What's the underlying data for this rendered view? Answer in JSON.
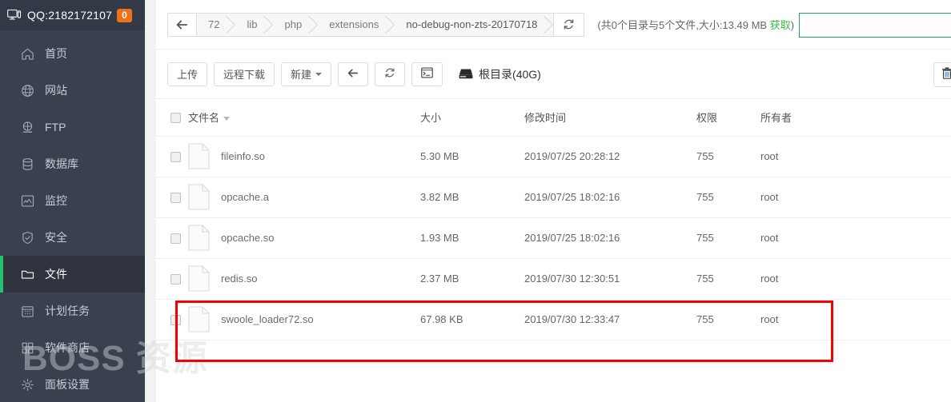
{
  "sidebar": {
    "header": {
      "icon": "monitor-icon",
      "qq_label": "QQ:2182172107",
      "badge_count": "0",
      "bg_color": "#333a47"
    },
    "bg_color": "#3a404d",
    "active_accent_color": "#25c16f",
    "watermark": "BOSS 资源",
    "items": [
      {
        "icon": "home-icon",
        "label": "首页",
        "active": false
      },
      {
        "icon": "globe-icon",
        "label": "网站",
        "active": false
      },
      {
        "icon": "ftp-icon",
        "label": "FTP",
        "active": false
      },
      {
        "icon": "database-icon",
        "label": "数据库",
        "active": false
      },
      {
        "icon": "monitor-chart-icon",
        "label": "监控",
        "active": false
      },
      {
        "icon": "shield-icon",
        "label": "安全",
        "active": false
      },
      {
        "icon": "folder-icon",
        "label": "文件",
        "active": true
      },
      {
        "icon": "calendar-icon",
        "label": "计划任务",
        "active": false
      },
      {
        "icon": "grid-icon",
        "label": "软件商店",
        "active": false
      },
      {
        "icon": "gear-icon",
        "label": "面板设置",
        "active": false
      }
    ]
  },
  "breadcrumb": {
    "back_icon": "arrow-left-icon",
    "crumbs": [
      "72",
      "lib",
      "php",
      "extensions",
      "no-debug-non-zts-20170718"
    ],
    "refresh_icon": "refresh-icon",
    "status_prefix": "(共0个目录与5个文件,大小:13.49 MB ",
    "status_link": "获取",
    "status_suffix": ")",
    "link_color": "#3ab44a"
  },
  "search": {
    "value": "",
    "placeholder": "",
    "border_color": "#26a65b"
  },
  "toolbar": {
    "buttons": [
      {
        "label": "上传",
        "icon": "",
        "caret": false
      },
      {
        "label": "远程下载",
        "icon": "",
        "caret": false
      },
      {
        "label": "新建",
        "icon": "",
        "caret": true
      },
      {
        "label": "",
        "icon": "arrow-left-icon",
        "caret": false
      },
      {
        "label": "",
        "icon": "refresh-icon",
        "caret": false
      },
      {
        "label": "",
        "icon": "terminal-icon",
        "caret": false
      }
    ],
    "disk_icon": "hard-drive-icon",
    "disk_label": "根目录(40G)",
    "trash_icon": "trash-icon"
  },
  "table": {
    "headers": {
      "select_all": "",
      "name": "文件名",
      "size": "大小",
      "mtime": "修改时间",
      "perm": "权限",
      "owner": "所有者"
    },
    "sort_column": "文件名",
    "sort_dir": "desc",
    "rows": [
      {
        "name": "fileinfo.so",
        "size": "5.30 MB",
        "mtime": "2019/07/25 20:28:12",
        "perm": "755",
        "owner": "root",
        "highlighted": false
      },
      {
        "name": "opcache.a",
        "size": "3.82 MB",
        "mtime": "2019/07/25 18:02:16",
        "perm": "755",
        "owner": "root",
        "highlighted": false
      },
      {
        "name": "opcache.so",
        "size": "1.93 MB",
        "mtime": "2019/07/25 18:02:16",
        "perm": "755",
        "owner": "root",
        "highlighted": false
      },
      {
        "name": "redis.so",
        "size": "2.37 MB",
        "mtime": "2019/07/30 12:30:51",
        "perm": "755",
        "owner": "root",
        "highlighted": false
      },
      {
        "name": "swoole_loader72.so",
        "size": "67.98 KB",
        "mtime": "2019/07/30 12:33:47",
        "perm": "755",
        "owner": "root",
        "highlighted": true
      }
    ]
  },
  "annotation": {
    "highlight_color": "#f60000",
    "target_row": "swoole_loader72.so"
  }
}
